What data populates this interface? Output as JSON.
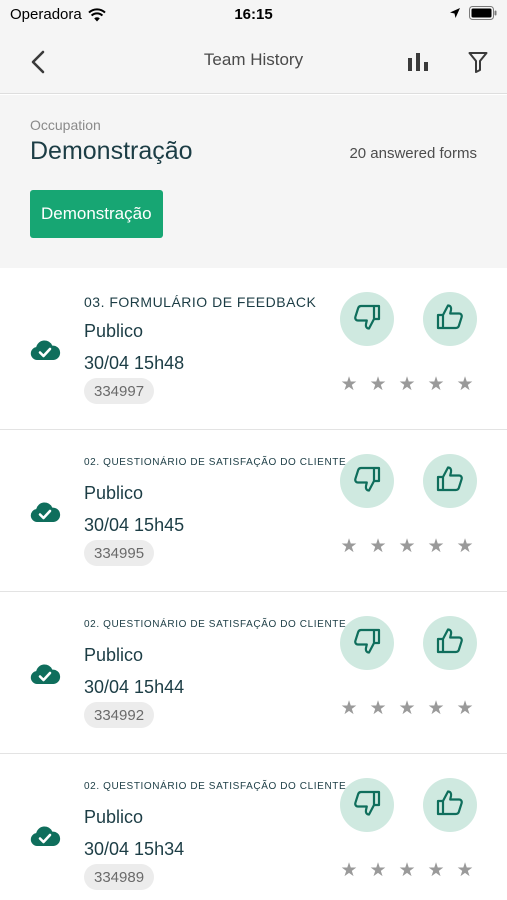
{
  "status_bar": {
    "carrier": "Operadora",
    "time": "16:15"
  },
  "nav": {
    "title": "Team History"
  },
  "header": {
    "occupation_label": "Occupation",
    "occupation_name": "Demonstração",
    "answered_forms": "20 answered forms",
    "chip_label": "Demonstração"
  },
  "colors": {
    "accent": "#17a673",
    "icon_teal": "#0f6e5c",
    "vote_bg": "#cfe9e0"
  },
  "icons": {
    "sync": "cloud-check-icon",
    "dislike": "thumbs-down-icon",
    "like": "thumbs-up-icon",
    "rating": "star-icon"
  },
  "forms": [
    {
      "title": "03. FORMULÁRIO DE FEEDBACK",
      "team": "Publico",
      "datetime": "30/04 15h48",
      "id": "334997",
      "rating": 0
    },
    {
      "title": "02. QUESTIONÁRIO DE SATISFAÇÃO DO CLIENTE",
      "team": "Publico",
      "datetime": "30/04 15h45",
      "id": "334995",
      "rating": 0
    },
    {
      "title": "02. QUESTIONÁRIO DE SATISFAÇÃO DO CLIENTE",
      "team": "Publico",
      "datetime": "30/04 15h44",
      "id": "334992",
      "rating": 0
    },
    {
      "title": "02. QUESTIONÁRIO DE SATISFAÇÃO DO CLIENTE",
      "team": "Publico",
      "datetime": "30/04 15h34",
      "id": "334989",
      "rating": 0
    }
  ]
}
